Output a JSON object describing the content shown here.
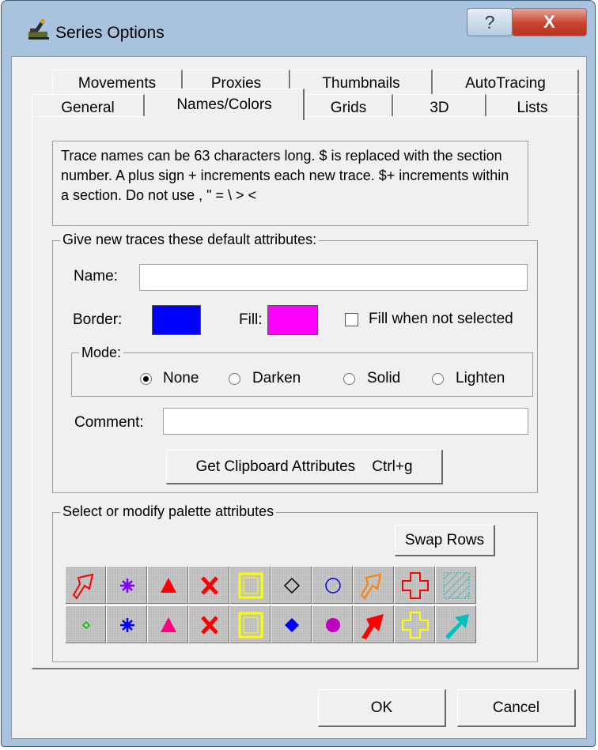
{
  "window": {
    "title": "Series Options",
    "help_glyph": "?",
    "close_glyph": "X"
  },
  "tabs": {
    "back_row": [
      "Movements",
      "Proxies",
      "Thumbnails",
      "AutoTracing"
    ],
    "front_row": [
      "General",
      "Names/Colors",
      "Grids",
      "3D",
      "Lists"
    ],
    "active": "Names/Colors"
  },
  "info_text": "Trace names can be 63 characters long. $ is replaced with the section number. A plus sign + increments each new trace. $+ increments within a section. Do not use , \" = \\ > <",
  "defaults_group": {
    "label": "Give new traces these default attributes:",
    "name_label": "Name:",
    "name_value": "",
    "border_label": "Border:",
    "border_color": "#0000ff",
    "fill_label": "Fill:",
    "fill_color": "#ff00ff",
    "fill_when_not_selected_label": "Fill when not selected",
    "fill_when_not_selected_checked": false,
    "mode_label": "Mode:",
    "mode_options": [
      "None",
      "Darken",
      "Solid",
      "Lighten"
    ],
    "mode_selected": "None",
    "comment_label": "Comment:",
    "comment_value": "",
    "get_clipboard_label": "Get Clipboard Attributes    Ctrl+g"
  },
  "palette_group": {
    "label": "Select or modify palette attributes",
    "swap_rows_label": "Swap Rows",
    "row1": [
      {
        "icon": "red-arrow-outline-icon",
        "color": "#ff0000"
      },
      {
        "icon": "purple-star-icon",
        "color": "#8000ff"
      },
      {
        "icon": "red-triangle-icon",
        "color": "#ff0000"
      },
      {
        "icon": "red-x-icon",
        "color": "#ff0000"
      },
      {
        "icon": "yellow-square-outline-icon",
        "color": "#ffff00"
      },
      {
        "icon": "black-diamond-outline-icon",
        "color": "#000000"
      },
      {
        "icon": "blue-circle-outline-icon",
        "color": "#0000ff"
      },
      {
        "icon": "orange-arrow-outline-icon",
        "color": "#ff8000"
      },
      {
        "icon": "red-cross-outline-icon",
        "color": "#ff0000"
      },
      {
        "icon": "cyan-hatched-square-icon",
        "color": "#00c0c0"
      }
    ],
    "row2": [
      {
        "icon": "green-diamond-small-icon",
        "color": "#00c000"
      },
      {
        "icon": "blue-star-icon",
        "color": "#0000ff"
      },
      {
        "icon": "magenta-triangle-icon",
        "color": "#ff0080"
      },
      {
        "icon": "red-x-icon",
        "color": "#ff0000"
      },
      {
        "icon": "yellow-square-outline-icon",
        "color": "#ffff00"
      },
      {
        "icon": "blue-diamond-filled-icon",
        "color": "#0000ff"
      },
      {
        "icon": "magenta-circle-filled-icon",
        "color": "#c000c0"
      },
      {
        "icon": "red-arrow-filled-icon",
        "color": "#ff0000"
      },
      {
        "icon": "yellow-cross-outline-icon",
        "color": "#ffff00"
      },
      {
        "icon": "cyan-arrow-filled-icon",
        "color": "#00c0c0"
      }
    ]
  },
  "footer": {
    "ok_label": "OK",
    "cancel_label": "Cancel"
  }
}
